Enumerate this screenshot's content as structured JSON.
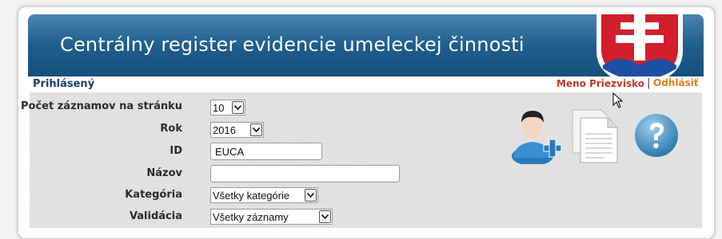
{
  "header": {
    "title": "Centrálny register evidencie umeleckej činnosti"
  },
  "userbar": {
    "logged_label": "Prihlásený",
    "username": "Meno Priezvisko",
    "separator": "|",
    "logout": "Odhlásiť"
  },
  "form": {
    "per_page": {
      "label": "Počet záznamov na stránku",
      "value": "10"
    },
    "year": {
      "label": "Rok",
      "value": "2016"
    },
    "id": {
      "label": "ID",
      "value": "EUCA"
    },
    "name": {
      "label": "Názov",
      "value": ""
    },
    "category": {
      "label": "Kategória",
      "value": "Všetky kategórie"
    },
    "validation": {
      "label": "Validácia",
      "value": "Všetky záznamy"
    }
  },
  "actions": {
    "add_user_icon": "add-user-icon",
    "documents_icon": "documents-icon",
    "help_icon": "help-icon"
  },
  "colors": {
    "banner": "#1f5f8f",
    "username": "#c0392b",
    "logout": "#e87c1e",
    "logged": "#1c3f6a"
  }
}
